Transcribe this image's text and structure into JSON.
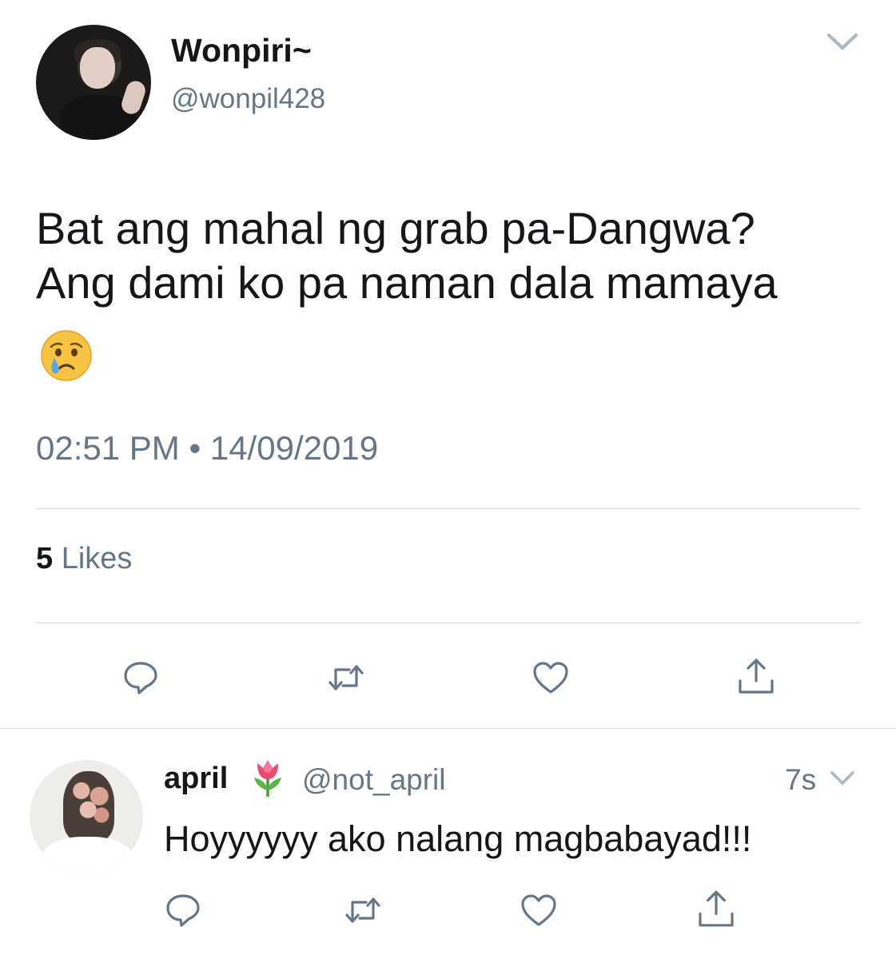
{
  "tweet": {
    "display_name": "Wonpiri~",
    "handle": "@wonpil428",
    "text_line1": "Bat ang mahal ng grab pa-Dangwa?",
    "text_line2": "Ang dami ko pa naman dala mamaya",
    "emoji": "crying-face",
    "time": "02:51 PM",
    "separator": "•",
    "date": "14/09/2019",
    "likes_count": "5",
    "likes_label": "Likes",
    "actions": [
      "reply-icon",
      "retweet-icon",
      "like-icon",
      "share-icon"
    ]
  },
  "reply": {
    "display_name": "april",
    "name_emoji": "tulip",
    "handle": "@not_april",
    "time_ago": "7s",
    "text": "Hoyyyyyy ako nalang magbabayad!!!",
    "actions": [
      "reply-icon",
      "retweet-icon",
      "like-icon",
      "share-icon"
    ]
  },
  "colors": {
    "text_primary": "#14171a",
    "text_secondary": "#657786",
    "divider": "#d6dbe0",
    "icon": "#657786"
  }
}
